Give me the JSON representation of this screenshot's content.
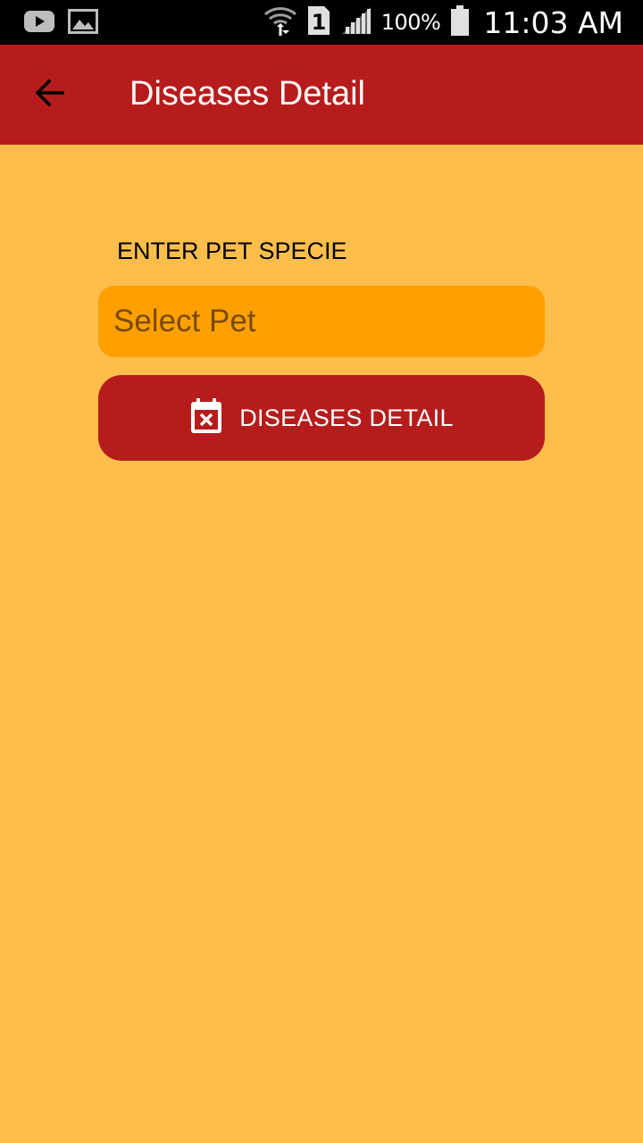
{
  "status_bar": {
    "icons": [
      "youtube-icon",
      "gallery-icon",
      "wifi-icon",
      "sim-icon",
      "signal-icon",
      "battery-icon"
    ],
    "sim_number": "1",
    "battery": "100%",
    "time": "11:03 AM"
  },
  "app_bar": {
    "back_icon": "arrow-back-icon",
    "title": "Diseases Detail"
  },
  "form": {
    "label": "ENTER PET SPECIE",
    "select_value": "Select Pet",
    "button_icon": "calendar-remove-icon",
    "button_label": "DISEASES DETAIL"
  },
  "colors": {
    "background": "#FFBE4C",
    "app_bar": "#B71C1C",
    "select_field": "#FFA000",
    "button": "#B71C1C"
  }
}
